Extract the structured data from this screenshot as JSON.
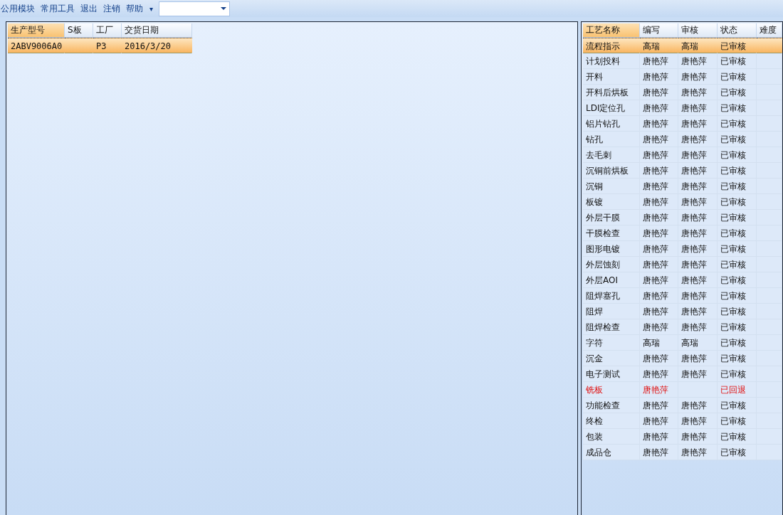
{
  "menu": {
    "items": [
      "公用模块",
      "常用工具",
      "退出",
      "注销",
      "帮助"
    ],
    "dropdown_caret": "▾"
  },
  "orders_table": {
    "columns": [
      "生产型号",
      "S板",
      "工厂",
      "交货日期"
    ],
    "rows": [
      {
        "cells": [
          "2ABV9006A0",
          "",
          "P3",
          "2016/3/20"
        ],
        "selected": true
      }
    ]
  },
  "process_table": {
    "columns": [
      "工艺名称",
      "编写",
      "审核",
      "状态",
      "难度"
    ],
    "rows": [
      {
        "cells": [
          "流程指示",
          "高瑞",
          "高瑞",
          "已审核",
          ""
        ],
        "selected": true,
        "kind": "approved"
      },
      {
        "cells": [
          "计划投料",
          "唐艳萍",
          "唐艳萍",
          "已审核",
          ""
        ],
        "selected": false,
        "kind": "approved"
      },
      {
        "cells": [
          "开料",
          "唐艳萍",
          "唐艳萍",
          "已审核",
          ""
        ],
        "selected": false,
        "kind": "approved"
      },
      {
        "cells": [
          "开料后烘板",
          "唐艳萍",
          "唐艳萍",
          "已审核",
          ""
        ],
        "selected": false,
        "kind": "approved"
      },
      {
        "cells": [
          "LDI定位孔",
          "唐艳萍",
          "唐艳萍",
          "已审核",
          ""
        ],
        "selected": false,
        "kind": "approved"
      },
      {
        "cells": [
          "铝片钻孔",
          "唐艳萍",
          "唐艳萍",
          "已审核",
          ""
        ],
        "selected": false,
        "kind": "approved"
      },
      {
        "cells": [
          "钻孔",
          "唐艳萍",
          "唐艳萍",
          "已审核",
          ""
        ],
        "selected": false,
        "kind": "approved"
      },
      {
        "cells": [
          "去毛刺",
          "唐艳萍",
          "唐艳萍",
          "已审核",
          ""
        ],
        "selected": false,
        "kind": "approved"
      },
      {
        "cells": [
          "沉铜前烘板",
          "唐艳萍",
          "唐艳萍",
          "已审核",
          ""
        ],
        "selected": false,
        "kind": "approved"
      },
      {
        "cells": [
          "沉铜",
          "唐艳萍",
          "唐艳萍",
          "已审核",
          ""
        ],
        "selected": false,
        "kind": "approved"
      },
      {
        "cells": [
          "板镀",
          "唐艳萍",
          "唐艳萍",
          "已审核",
          ""
        ],
        "selected": false,
        "kind": "approved"
      },
      {
        "cells": [
          "外层干膜",
          "唐艳萍",
          "唐艳萍",
          "已审核",
          ""
        ],
        "selected": false,
        "kind": "approved"
      },
      {
        "cells": [
          "干膜检查",
          "唐艳萍",
          "唐艳萍",
          "已审核",
          ""
        ],
        "selected": false,
        "kind": "approved"
      },
      {
        "cells": [
          "图形电镀",
          "唐艳萍",
          "唐艳萍",
          "已审核",
          ""
        ],
        "selected": false,
        "kind": "approved"
      },
      {
        "cells": [
          "外层蚀刻",
          "唐艳萍",
          "唐艳萍",
          "已审核",
          ""
        ],
        "selected": false,
        "kind": "approved"
      },
      {
        "cells": [
          "外层AOI",
          "唐艳萍",
          "唐艳萍",
          "已审核",
          ""
        ],
        "selected": false,
        "kind": "approved"
      },
      {
        "cells": [
          "阻焊塞孔",
          "唐艳萍",
          "唐艳萍",
          "已审核",
          ""
        ],
        "selected": false,
        "kind": "approved"
      },
      {
        "cells": [
          "阻焊",
          "唐艳萍",
          "唐艳萍",
          "已审核",
          ""
        ],
        "selected": false,
        "kind": "approved"
      },
      {
        "cells": [
          "阻焊检查",
          "唐艳萍",
          "唐艳萍",
          "已审核",
          ""
        ],
        "selected": false,
        "kind": "approved"
      },
      {
        "cells": [
          "字符",
          "高瑞",
          "高瑞",
          "已审核",
          ""
        ],
        "selected": false,
        "kind": "approved"
      },
      {
        "cells": [
          "沉金",
          "唐艳萍",
          "唐艳萍",
          "已审核",
          ""
        ],
        "selected": false,
        "kind": "approved"
      },
      {
        "cells": [
          "电子测试",
          "唐艳萍",
          "唐艳萍",
          "已审核",
          ""
        ],
        "selected": false,
        "kind": "approved"
      },
      {
        "cells": [
          "铣板",
          "唐艳萍",
          "",
          "已回退",
          ""
        ],
        "selected": false,
        "kind": "returned"
      },
      {
        "cells": [
          "功能检查",
          "唐艳萍",
          "唐艳萍",
          "已审核",
          ""
        ],
        "selected": false,
        "kind": "approved"
      },
      {
        "cells": [
          "终检",
          "唐艳萍",
          "唐艳萍",
          "已审核",
          ""
        ],
        "selected": false,
        "kind": "approved"
      },
      {
        "cells": [
          "包装",
          "唐艳萍",
          "唐艳萍",
          "已审核",
          ""
        ],
        "selected": false,
        "kind": "approved"
      },
      {
        "cells": [
          "成品仓",
          "唐艳萍",
          "唐艳萍",
          "已审核",
          ""
        ],
        "selected": false,
        "kind": "approved"
      }
    ]
  }
}
